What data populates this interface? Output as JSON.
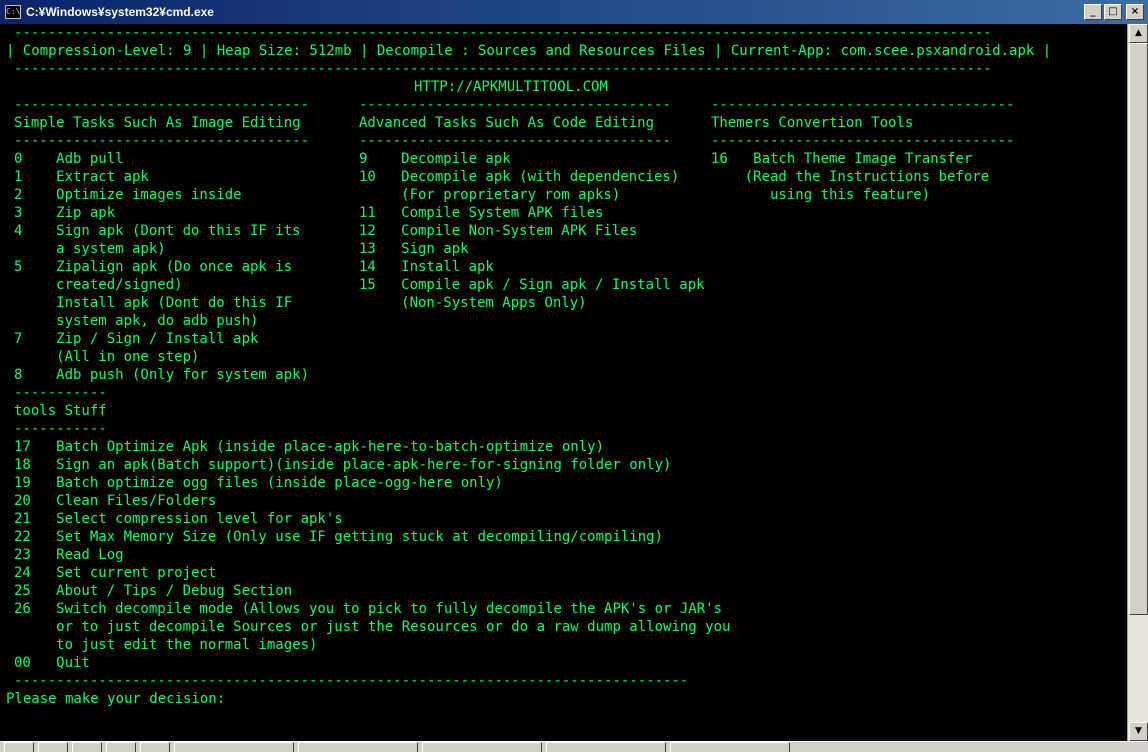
{
  "window": {
    "title": "C:¥Windows¥system32¥cmd.exe",
    "icon_label": "C:\\",
    "minimize_glyph": "_",
    "maximize_glyph": "□",
    "close_glyph": "×"
  },
  "console": {
    "sep_full": "--------------------------------------------------------------------------------------------------------------------",
    "status_line": "| Compression-Level: 9 | Heap Size: 512mb | Decompile : Sources and Resources Files | Current-App: com.scee.psxandroid.apk |",
    "site": "HTTP://APKMULTITOOL.COM",
    "sep_col1": "-----------------------------------",
    "sep_col2": "-------------------------------------",
    "sep_col3": "------------------------------------",
    "col1_header": "Simple Tasks Such As Image Editing",
    "col2_header": "Advanced Tasks Such As Code Editing",
    "col3_header": "Themers Convertion Tools",
    "col1_lines": [
      "0    Adb pull",
      "1    Extract apk",
      "2    Optimize images inside",
      "3    Zip apk",
      "4    Sign apk (Dont do this IF its",
      "     a system apk)",
      "5    Zipalign apk (Do once apk is",
      "     created/signed)",
      "     Install apk (Dont do this IF",
      "     system apk, do adb push)",
      "7    Zip / Sign / Install apk",
      "     (All in one step)",
      "8    Adb push (Only for system apk)"
    ],
    "col2_lines": [
      "9    Decompile apk",
      "10   Decompile apk (with dependencies)",
      "     (For proprietary rom apks)",
      "11   Compile System APK files",
      "12   Compile Non-System APK Files",
      "13   Sign apk",
      "14   Install apk",
      "15   Compile apk / Sign apk / Install apk",
      "     (Non-System Apps Only)"
    ],
    "col3_lines": [
      "16   Batch Theme Image Transfer",
      "    (Read the Instructions before",
      "       using this feature)"
    ],
    "sep_tools": "-----------",
    "tools_header": "tools Stuff",
    "tools_lines": [
      "17   Batch Optimize Apk (inside place-apk-here-to-batch-optimize only)",
      "18   Sign an apk(Batch support)(inside place-apk-here-for-signing folder only)",
      "19   Batch optimize ogg files (inside place-ogg-here only)",
      "20   Clean Files/Folders",
      "21   Select compression level for apk's",
      "22   Set Max Memory Size (Only use IF getting stuck at decompiling/compiling)",
      "23   Read Log",
      "24   Set current project",
      "25   About / Tips / Debug Section",
      "26   Switch decompile mode (Allows you to pick to fully decompile the APK's or JAR's",
      "     or to just decompile Sources or just the Resources or do a raw dump allowing you",
      "     to just edit the normal images)",
      "00   Quit"
    ],
    "sep_bottom": "--------------------------------------------------------------------------------",
    "prompt": "Please make your decision:"
  },
  "scrollbar": {
    "up_glyph": "▲",
    "down_glyph": "▼"
  }
}
